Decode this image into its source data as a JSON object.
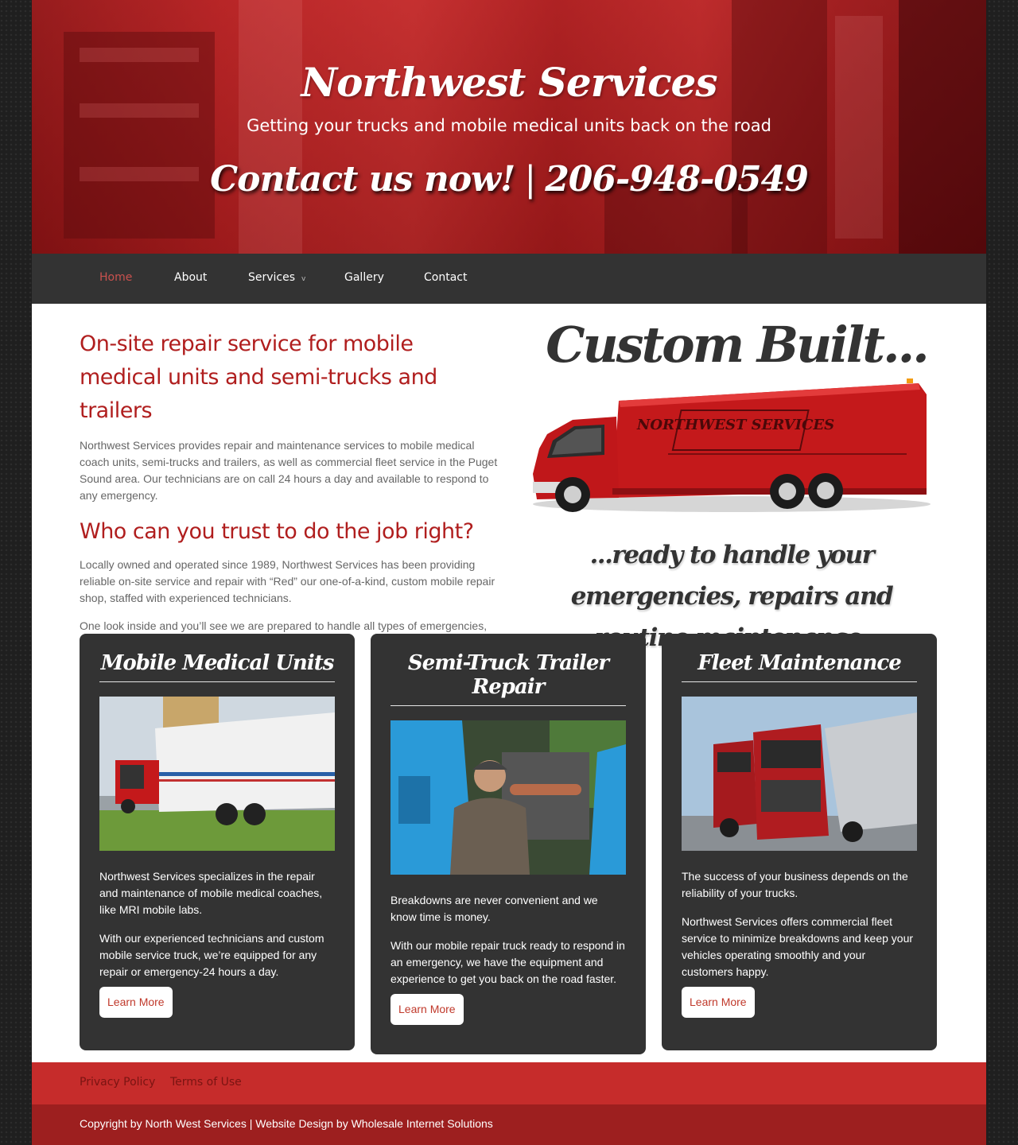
{
  "header": {
    "site_title": "Northwest Services",
    "tagline": "Getting your trucks and mobile medical units back on the road",
    "contact_label": "Contact us now!",
    "separator": "|",
    "phone": "206-948-0549"
  },
  "nav": {
    "items": [
      {
        "label": "Home",
        "active": true
      },
      {
        "label": "About"
      },
      {
        "label": "Services",
        "has_submenu": true
      },
      {
        "label": "Gallery"
      },
      {
        "label": "Contact"
      }
    ],
    "submenu_indicator": "v"
  },
  "intro": {
    "heading": "On-site repair service for mobile medical units and semi-trucks and trailers",
    "paragraph1": "Northwest Services provides repair and maintenance services to mobile medical coach units, semi-trucks and trailers, as well as commercial fleet service in the Puget Sound area. Our technicians are on call 24 hours a day and available to respond to any emergency.",
    "subheading": "Who can you trust to do the job right?",
    "paragraph2": "Locally owned and operated since 1989, Northwest Services has been providing reliable on-site service and repair with “Red” our one-of-a-kind, custom mobile repair shop, staffed with experienced technicians.",
    "paragraph3": "One look inside and you’ll see we are prepared to handle all types of emergencies, repairs and maintenance."
  },
  "promo": {
    "custom_built": "Custom Built...",
    "truck_lettering": "NORTHWEST SERVICES",
    "ready_line": "...ready to handle your emergencies, repairs and routine maintenance."
  },
  "cards": [
    {
      "title": "Mobile Medical Units",
      "p1": "Northwest Services specializes in the repair and maintenance of mobile medical coaches, like MRI mobile labs.",
      "p2": "With our experienced technicians and custom mobile service truck, we’re equipped for any repair or emergency-24 hours a day.",
      "button": "Learn More"
    },
    {
      "title": "Semi-Truck Trailer Repair",
      "p1": "Breakdowns are never convenient and we know time is money.",
      "p2": "With our mobile repair truck ready to respond in an emergency, we have the equipment and experience to get you back on the road faster.",
      "button": "Learn More"
    },
    {
      "title": "Fleet Maintenance",
      "p1": "The success of your business depends on the reliability of your trucks.",
      "p2": "Northwest Services offers commercial fleet service to minimize breakdowns and keep your vehicles operating smoothly and your customers happy.",
      "button": "Learn More"
    }
  ],
  "footer": {
    "links": [
      "Privacy Policy",
      "Terms of Use"
    ],
    "copyright": "Copyright by North West Services | Website Design by Wholesale Internet Solutions"
  },
  "colors": {
    "accent_red": "#b01e1e",
    "nav_bg": "#333333",
    "card_bg": "#333333",
    "footer_red": "#c62c2b",
    "footer_dark_red": "#9d1f1f",
    "nav_active": "#c9514e"
  }
}
